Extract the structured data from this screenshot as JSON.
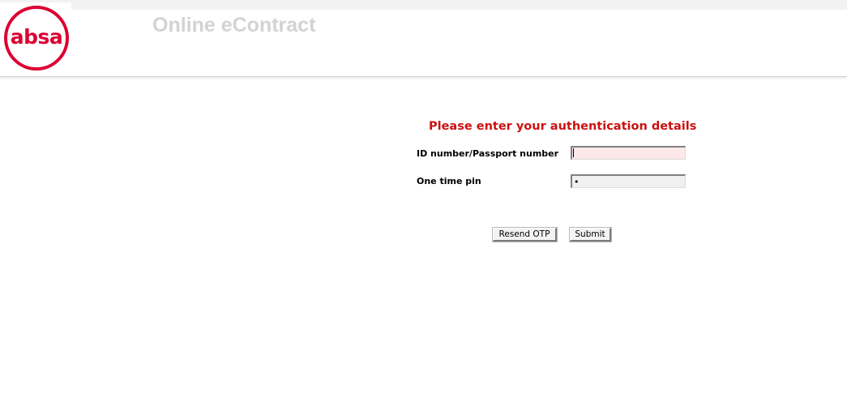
{
  "header": {
    "logo_text": "absa",
    "title": "Online eContract"
  },
  "form": {
    "heading": "Please enter your authentication details",
    "id_label": "ID number/Passport number",
    "id_value": "",
    "otp_label": "One time pin",
    "otp_value": "•",
    "resend_label": "Resend OTP",
    "submit_label": "Submit"
  },
  "colors": {
    "brand_red": "#dc0032",
    "heading_red": "#cc1111",
    "title_grey": "#d3d3d3"
  }
}
